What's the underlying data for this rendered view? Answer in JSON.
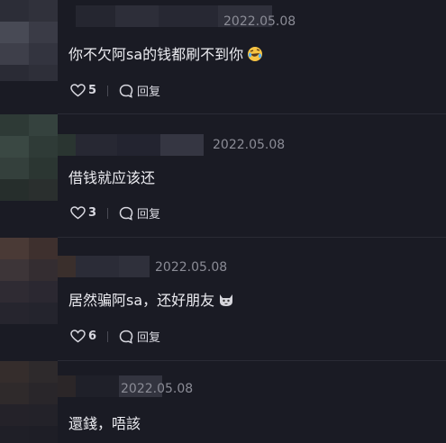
{
  "comments": [
    {
      "date": "2022.05.08",
      "text": "你不欠阿sa的钱都刷不到你",
      "emoji": "rolling-laughing-emoji",
      "likes": "5",
      "reply_label": "回复"
    },
    {
      "date": "2022.05.08",
      "text": "借钱就应该还",
      "likes": "3",
      "reply_label": "回复"
    },
    {
      "date": "2022.05.08",
      "text": "居然骗阿sa，还好朋友",
      "emoji": "cat-emoji",
      "likes": "6",
      "reply_label": "回复"
    },
    {
      "date": "2022.05.08",
      "text": "還錢，唔該"
    }
  ]
}
